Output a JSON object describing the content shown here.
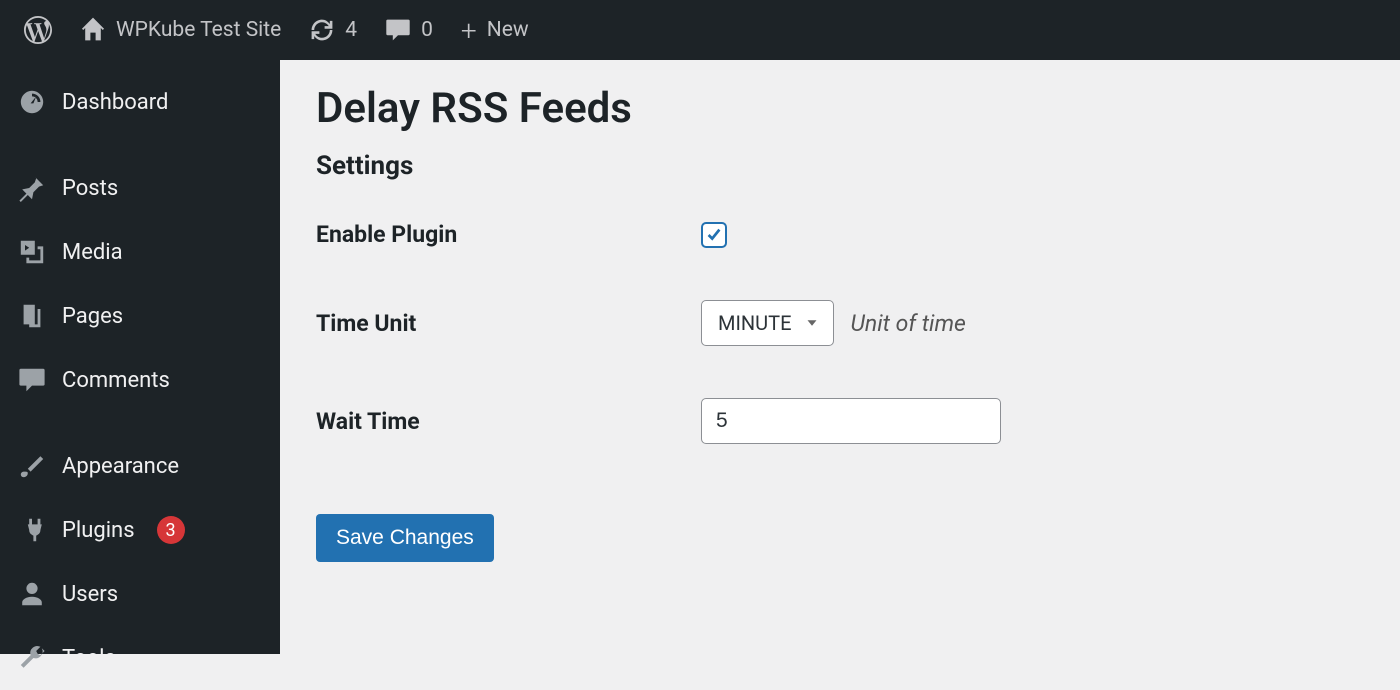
{
  "adminbar": {
    "site_name": "WPKube Test Site",
    "updates_count": "4",
    "comments_count": "0",
    "new_label": "New"
  },
  "sidebar": {
    "items": [
      {
        "label": "Dashboard"
      },
      {
        "label": "Posts"
      },
      {
        "label": "Media"
      },
      {
        "label": "Pages"
      },
      {
        "label": "Comments"
      },
      {
        "label": "Appearance"
      },
      {
        "label": "Plugins",
        "badge": "3"
      },
      {
        "label": "Users"
      },
      {
        "label": "Tools"
      }
    ]
  },
  "main": {
    "title": "Delay RSS Feeds",
    "subtitle": "Settings",
    "enable_label": "Enable Plugin",
    "enable_checked": true,
    "time_unit_label": "Time Unit",
    "time_unit_value": "MINUTE",
    "time_unit_hint": "Unit of time",
    "wait_label": "Wait Time",
    "wait_value": "5",
    "save_label": "Save Changes"
  }
}
